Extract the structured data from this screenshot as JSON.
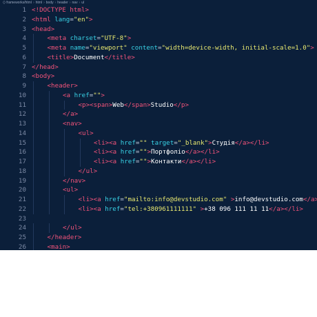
{
  "breadcrumb": {
    "items": [
      "⟨⟩ frameworks/html",
      "html",
      "body",
      "header",
      "nav",
      "ul"
    ]
  },
  "colors": {
    "background": "#0b1f3a",
    "tag": "#f2537a",
    "attribute": "#39d2e6",
    "string": "#e8e870",
    "text": "#ffffff",
    "line_number": "#7c8aa5"
  },
  "lines": [
    {
      "n": "1",
      "indent": 0,
      "tokens": [
        [
          "doc",
          "<!DOCTYPE html>"
        ]
      ]
    },
    {
      "n": "2",
      "indent": 0,
      "tokens": [
        [
          "tag",
          "<html"
        ],
        [
          "attr",
          " lang"
        ],
        [
          "pun",
          "="
        ],
        [
          "str",
          "\"en\""
        ],
        [
          "tag",
          ">"
        ]
      ]
    },
    {
      "n": "3",
      "indent": 0,
      "tokens": [
        [
          "tag",
          "<head>"
        ]
      ]
    },
    {
      "n": "4",
      "indent": 1,
      "tokens": [
        [
          "tag",
          "<meta"
        ],
        [
          "attr",
          " charset"
        ],
        [
          "pun",
          "="
        ],
        [
          "str",
          "\"UTF-8\""
        ],
        [
          "tag",
          ">"
        ]
      ]
    },
    {
      "n": "5",
      "indent": 1,
      "tokens": [
        [
          "tag",
          "<meta"
        ],
        [
          "attr",
          " name"
        ],
        [
          "pun",
          "="
        ],
        [
          "str",
          "\"viewport\""
        ],
        [
          "attr",
          " content"
        ],
        [
          "pun",
          "="
        ],
        [
          "str",
          "\"width=device-width, initial-scale=1.0\""
        ],
        [
          "tag",
          ">"
        ]
      ]
    },
    {
      "n": "6",
      "indent": 1,
      "tokens": [
        [
          "tag",
          "<title>"
        ],
        [
          "txt",
          "Document"
        ],
        [
          "tag",
          "</title>"
        ]
      ]
    },
    {
      "n": "7",
      "indent": 0,
      "tokens": [
        [
          "tag",
          "</head>"
        ]
      ]
    },
    {
      "n": "8",
      "indent": 0,
      "tokens": [
        [
          "tag",
          "<body>"
        ]
      ]
    },
    {
      "n": "9",
      "indent": 1,
      "tokens": [
        [
          "tag",
          "<header>"
        ]
      ]
    },
    {
      "n": "10",
      "indent": 2,
      "tokens": [
        [
          "tag",
          "<a"
        ],
        [
          "attr",
          " href"
        ],
        [
          "pun",
          "="
        ],
        [
          "str",
          "\"\""
        ],
        [
          "tag",
          ">"
        ]
      ]
    },
    {
      "n": "11",
      "indent": 3,
      "tokens": [
        [
          "tag",
          "<p><span>"
        ],
        [
          "txt",
          "Web"
        ],
        [
          "tag",
          "</span>"
        ],
        [
          "txt",
          "Studio"
        ],
        [
          "tag",
          "</p>"
        ]
      ]
    },
    {
      "n": "12",
      "indent": 2,
      "tokens": [
        [
          "tag",
          "</a>"
        ]
      ]
    },
    {
      "n": "13",
      "indent": 2,
      "tokens": [
        [
          "tag",
          "<nav>"
        ]
      ]
    },
    {
      "n": "14",
      "indent": 3,
      "tokens": [
        [
          "tag",
          "<ul>"
        ]
      ]
    },
    {
      "n": "15",
      "indent": 4,
      "tokens": [
        [
          "tag",
          "<li><a"
        ],
        [
          "attr",
          " href"
        ],
        [
          "pun",
          "="
        ],
        [
          "str",
          "\"\""
        ],
        [
          "attr",
          " target"
        ],
        [
          "pun",
          "="
        ],
        [
          "str",
          "\"_blank\""
        ],
        [
          "tag",
          ">"
        ],
        [
          "txt",
          "Студія"
        ],
        [
          "tag",
          "</a></li>"
        ]
      ]
    },
    {
      "n": "16",
      "indent": 4,
      "tokens": [
        [
          "tag",
          "<li><a"
        ],
        [
          "attr",
          " href"
        ],
        [
          "pun",
          "="
        ],
        [
          "str",
          "\"\""
        ],
        [
          "tag",
          ">"
        ],
        [
          "txt",
          "Портфоліо"
        ],
        [
          "tag",
          "</a></li>"
        ]
      ]
    },
    {
      "n": "17",
      "indent": 4,
      "tokens": [
        [
          "tag",
          "<li><a"
        ],
        [
          "attr",
          " href"
        ],
        [
          "pun",
          "="
        ],
        [
          "str",
          "\"\""
        ],
        [
          "tag",
          ">"
        ],
        [
          "txt",
          "Контакти"
        ],
        [
          "tag",
          "</a></li>"
        ]
      ]
    },
    {
      "n": "18",
      "indent": 3,
      "tokens": [
        [
          "tag",
          "</ul>"
        ]
      ]
    },
    {
      "n": "19",
      "indent": 2,
      "tokens": [
        [
          "tag",
          "</nav>"
        ]
      ]
    },
    {
      "n": "20",
      "indent": 2,
      "tokens": [
        [
          "tag",
          "<ul>"
        ]
      ]
    },
    {
      "n": "21",
      "indent": 3,
      "tokens": [
        [
          "tag",
          "<li><a"
        ],
        [
          "attr",
          " href"
        ],
        [
          "pun",
          "="
        ],
        [
          "str",
          "\"mailto:info@devstudio.com\""
        ],
        [
          "txt",
          " "
        ],
        [
          "tag",
          ">"
        ],
        [
          "txt",
          "info@devstudio.com"
        ],
        [
          "tag",
          "</a></li>"
        ]
      ]
    },
    {
      "n": "22",
      "indent": 3,
      "tokens": [
        [
          "tag",
          "<li><a"
        ],
        [
          "attr",
          " href"
        ],
        [
          "pun",
          "="
        ],
        [
          "str",
          "\"tel:+380961111111\""
        ],
        [
          "txt",
          " "
        ],
        [
          "tag",
          ">"
        ],
        [
          "txt",
          "+38 096 111 11 11"
        ],
        [
          "tag",
          "</a></li>"
        ]
      ]
    },
    {
      "n": "23",
      "indent": 0,
      "tokens": []
    },
    {
      "n": "24",
      "indent": 2,
      "tokens": [
        [
          "tag",
          "</ul>"
        ]
      ]
    },
    {
      "n": "25",
      "indent": 1,
      "tokens": [
        [
          "tag",
          "</header>"
        ]
      ]
    },
    {
      "n": "26",
      "indent": 1,
      "tokens": [
        [
          "tag",
          "<main>"
        ]
      ]
    }
  ]
}
